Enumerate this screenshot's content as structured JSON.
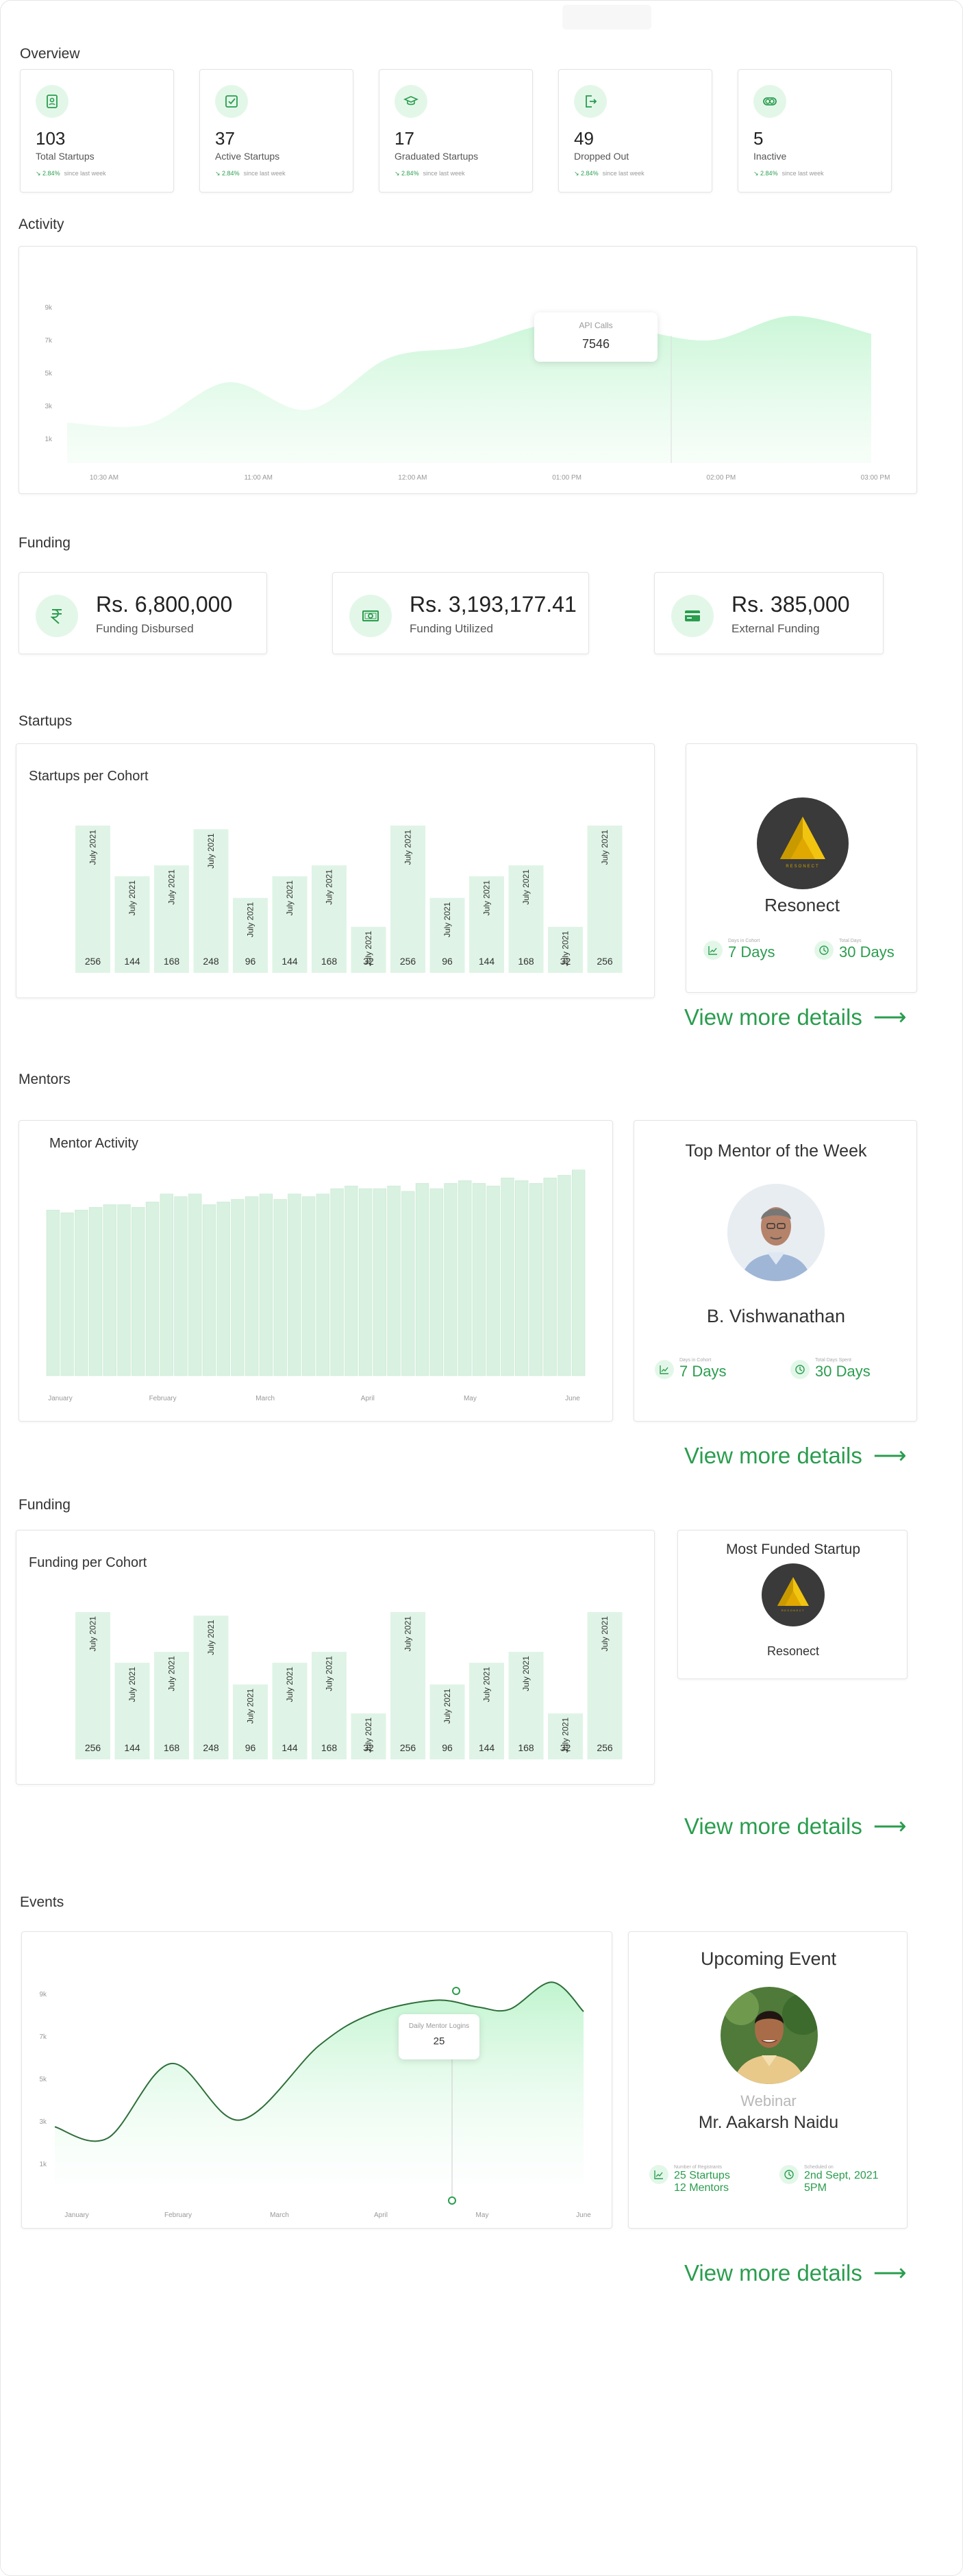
{
  "overview": {
    "title": "Overview",
    "stats": [
      {
        "value": "103",
        "label": "Total Startups",
        "change": "2.84%",
        "note": "since last week",
        "icon": "id-badge-icon"
      },
      {
        "value": "37",
        "label": "Active Startups",
        "change": "2.84%",
        "note": "since last week",
        "icon": "check-square-icon"
      },
      {
        "value": "17",
        "label": "Graduated Startups",
        "change": "2.84%",
        "note": "since last week",
        "icon": "graduation-cap-icon"
      },
      {
        "value": "49",
        "label": "Dropped Out",
        "change": "2.84%",
        "note": "since last week",
        "icon": "exit-icon"
      },
      {
        "value": "5",
        "label": "Inactive",
        "change": "2.84%",
        "note": "since last week",
        "icon": "toggle-off-icon"
      }
    ]
  },
  "activity": {
    "title": "Activity",
    "tooltip_label": "API Calls",
    "tooltip_value": "7546",
    "chart_data": {
      "type": "area",
      "y_ticks": [
        "9k",
        "7k",
        "5k",
        "3k",
        "1k"
      ],
      "x_ticks": [
        "10:30 AM",
        "11:00 AM",
        "12:00 AM",
        "01:00 PM",
        "02:00 PM",
        "03:00 PM"
      ],
      "x": [
        0,
        0.5,
        1,
        1.5,
        2,
        2.5,
        3,
        3.5,
        4,
        4.5,
        5
      ],
      "values": [
        2500,
        2400,
        5000,
        3300,
        6500,
        7200,
        8600,
        8300,
        7600,
        9100,
        8000
      ]
    }
  },
  "funding": {
    "title": "Funding",
    "cards": [
      {
        "amount": "Rs. 6,800,000",
        "label": "Funding Disbursed",
        "icon": "rupee-icon"
      },
      {
        "amount": "Rs. 3,193,177.41",
        "label": "Funding Utilized",
        "icon": "cash-icon"
      },
      {
        "amount": "Rs. 385,000",
        "label": "External Funding",
        "icon": "card-icon"
      }
    ]
  },
  "startups": {
    "title": "Startups",
    "chart_title": "Startups per Cohort",
    "chart_data": {
      "type": "bar",
      "categories": [
        "July 2021",
        "July 2021",
        "July 2021",
        "July 2021",
        "July 2021",
        "July 2021",
        "July 2021",
        "July 2021",
        "July 2021",
        "July 2021",
        "July 2021",
        "July 2021",
        "July 2021",
        "July 2021"
      ],
      "values": [
        256,
        144,
        168,
        248,
        96,
        144,
        168,
        32,
        256,
        96,
        144,
        168,
        32,
        256
      ]
    },
    "featured_name": "Resonect",
    "logo_text": "RESONECT",
    "metric1_caption": "Days in Cohort",
    "metric1_value": "7 Days",
    "metric2_caption": "Total Days",
    "metric2_value": "30 Days",
    "view_more": "View more details",
    "arrow": "⟶"
  },
  "mentors": {
    "title": "Mentors",
    "chart_title": "Mentor Activity",
    "chart_data": {
      "type": "bar",
      "x_ticks": [
        "January",
        "February",
        "March",
        "April",
        "May",
        "June"
      ],
      "values": [
        62,
        61,
        62,
        63,
        64,
        64,
        63,
        65,
        68,
        67,
        68,
        64,
        65,
        66,
        67,
        68,
        66,
        68,
        67,
        68,
        70,
        71,
        70,
        70,
        71,
        69,
        72,
        70,
        72,
        73,
        72,
        71,
        74,
        73,
        72,
        74,
        75,
        77
      ]
    },
    "card_title": "Top Mentor of the Week",
    "mentor_name": "B. Vishwanathan",
    "metric1_caption": "Days in Cohort",
    "metric1_value": "7 Days",
    "metric2_caption": "Total Days Spent",
    "metric2_value": "30 Days",
    "view_more": "View more details",
    "arrow": "⟶"
  },
  "funding2": {
    "title": "Funding",
    "chart_title": "Funding per Cohort",
    "chart_data": {
      "type": "bar",
      "categories": [
        "July 2021",
        "July 2021",
        "July 2021",
        "July 2021",
        "July 2021",
        "July 2021",
        "July 2021",
        "July 2021",
        "July 2021",
        "July 2021",
        "July 2021",
        "July 2021",
        "July 2021",
        "July 2021"
      ],
      "values": [
        256,
        144,
        168,
        248,
        96,
        144,
        168,
        32,
        256,
        96,
        144,
        168,
        32,
        256
      ]
    },
    "card_title": "Most Funded Startup",
    "startup_name": "Resonect",
    "logo_text": "RESONECT",
    "view_more": "View more details",
    "arrow": "⟶"
  },
  "events": {
    "title": "Events",
    "tooltip_label": "Daily Mentor Logins",
    "tooltip_value": "25",
    "chart_data": {
      "type": "line",
      "y_ticks": [
        "9k",
        "7k",
        "5k",
        "3k",
        "1k"
      ],
      "x_ticks": [
        "January",
        "February",
        "March",
        "April",
        "May",
        "June"
      ],
      "x": [
        0,
        0.5,
        1.1,
        1.75,
        2.5,
        3.0,
        3.6,
        4.0,
        4.3,
        4.7,
        5.0
      ],
      "values": [
        3200,
        2700,
        6000,
        3500,
        6800,
        8200,
        8800,
        8500,
        8400,
        9600,
        8300
      ]
    },
    "card_title": "Upcoming Event",
    "event_type": "Webinar",
    "speaker": "Mr. Aakarsh Naidu",
    "metric1_caption": "Number of Registrants",
    "metric1_line1": "25 Startups",
    "metric1_line2": "12 Mentors",
    "metric2_caption": "Scheduled on",
    "metric2_line1": "2nd Sept, 2021",
    "metric2_line2": "5PM",
    "view_more": "View more details",
    "arrow": "⟶"
  }
}
